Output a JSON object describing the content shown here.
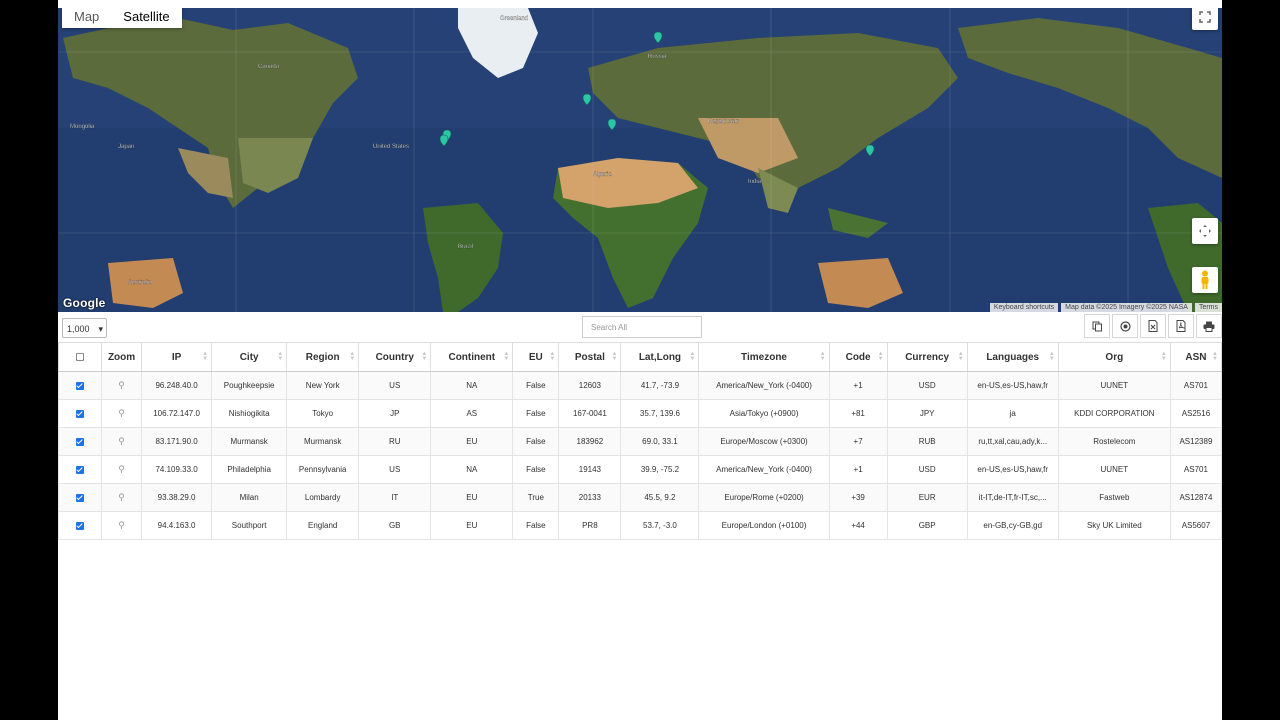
{
  "map": {
    "types": [
      "Map",
      "Satellite"
    ],
    "active_type": "Satellite",
    "logo": "Google",
    "attribution": [
      "Keyboard shortcuts",
      "Map data ©2025 Imagery ©2025 NASA",
      "Terms"
    ],
    "labels": [
      "Greenland",
      "Russia",
      "United States",
      "Brazil",
      "Australia",
      "Kazakhstan",
      "India",
      "Algeria",
      "Japan",
      "Mongolia",
      "Canada"
    ],
    "marker_color": "#2ec4a6"
  },
  "toolbar": {
    "page_size": "1,000",
    "search_placeholder": "Search All",
    "icons": [
      "copy-icon",
      "columns-icon",
      "excel-icon",
      "pdf-icon",
      "print-icon"
    ]
  },
  "table": {
    "columns": [
      "Zoom",
      "IP",
      "City",
      "Region",
      "Country",
      "Continent",
      "EU",
      "Postal",
      "Lat,Long",
      "Timezone",
      "Code",
      "Currency",
      "Languages",
      "Org",
      "ASN"
    ],
    "rows": [
      {
        "checked": true,
        "ip": "96.248.40.0",
        "city": "Poughkeepsie",
        "region": "New York",
        "country": "US",
        "continent": "NA",
        "eu": "False",
        "postal": "12603",
        "latlong": "41.7, -73.9",
        "timezone": "America/New_York (-0400)",
        "code": "+1",
        "currency": "USD",
        "languages": "en-US,es-US,haw,fr",
        "org": "UUNET",
        "asn": "AS701"
      },
      {
        "checked": true,
        "ip": "106.72.147.0",
        "city": "Nishiogikita",
        "region": "Tokyo",
        "country": "JP",
        "continent": "AS",
        "eu": "False",
        "postal": "167-0041",
        "latlong": "35.7, 139.6",
        "timezone": "Asia/Tokyo (+0900)",
        "code": "+81",
        "currency": "JPY",
        "languages": "ja",
        "org": "KDDI CORPORATION",
        "asn": "AS2516"
      },
      {
        "checked": true,
        "ip": "83.171.90.0",
        "city": "Murmansk",
        "region": "Murmansk",
        "country": "RU",
        "continent": "EU",
        "eu": "False",
        "postal": "183962",
        "latlong": "69.0, 33.1",
        "timezone": "Europe/Moscow (+0300)",
        "code": "+7",
        "currency": "RUB",
        "languages": "ru,tt,xal,cau,ady,k...",
        "org": "Rostelecom",
        "asn": "AS12389"
      },
      {
        "checked": true,
        "ip": "74.109.33.0",
        "city": "Philadelphia",
        "region": "Pennsylvania",
        "country": "US",
        "continent": "NA",
        "eu": "False",
        "postal": "19143",
        "latlong": "39.9, -75.2",
        "timezone": "America/New_York (-0400)",
        "code": "+1",
        "currency": "USD",
        "languages": "en-US,es-US,haw,fr",
        "org": "UUNET",
        "asn": "AS701"
      },
      {
        "checked": true,
        "ip": "93.38.29.0",
        "city": "Milan",
        "region": "Lombardy",
        "country": "IT",
        "continent": "EU",
        "eu": "True",
        "postal": "20133",
        "latlong": "45.5, 9.2",
        "timezone": "Europe/Rome (+0200)",
        "code": "+39",
        "currency": "EUR",
        "languages": "it-IT,de-IT,fr-IT,sc,...",
        "org": "Fastweb",
        "asn": "AS12874"
      },
      {
        "checked": true,
        "ip": "94.4.163.0",
        "city": "Southport",
        "region": "England",
        "country": "GB",
        "continent": "EU",
        "eu": "False",
        "postal": "PR8",
        "latlong": "53.7, -3.0",
        "timezone": "Europe/London (+0100)",
        "code": "+44",
        "currency": "GBP",
        "languages": "en-GB,cy-GB,gd",
        "org": "Sky UK Limited",
        "asn": "AS5607"
      }
    ]
  }
}
